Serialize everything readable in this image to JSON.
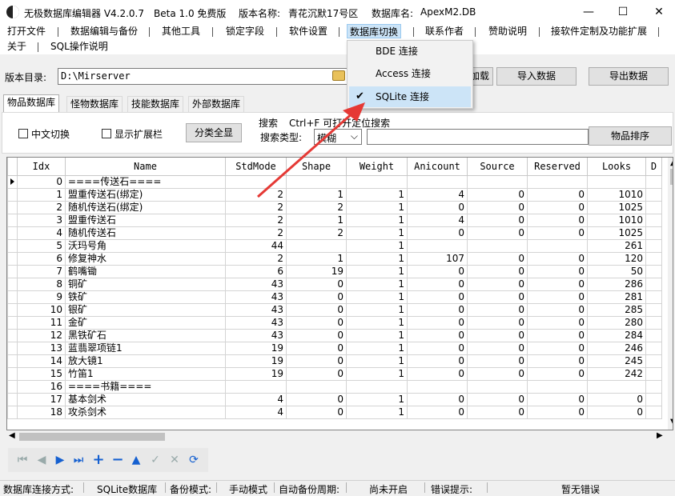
{
  "window": {
    "title": "无极数据库编辑器 V4.2.0.7",
    "edition": "Beta 1.0 免费版",
    "version_label": "版本名称:",
    "version_value": "青花沉默17号区",
    "db_label": "数据库名:",
    "db_value": "ApexM2.DB"
  },
  "menu": [
    "打开文件",
    "数据编辑与备份",
    "其他工具",
    "锁定字段",
    "软件设置",
    "数据库切换",
    "联系作者",
    "赞助说明",
    "接软件定制及功能扩展",
    "关于",
    "SQL操作说明"
  ],
  "dropdown": {
    "items": [
      "BDE 连接",
      "Access 连接",
      "SQLite 连接"
    ],
    "checked": 2
  },
  "pathbar": {
    "label": "版本目录:",
    "path": "D:\\Mirserver",
    "load_btn": "加载数",
    "import_btn": "导入数据",
    "export_btn": "导出数据"
  },
  "tabs": [
    "物品数据库",
    "怪物数据库",
    "技能数据库",
    "外部数据库"
  ],
  "toolpanel": {
    "chinese_switch": "中文切换",
    "show_ext": "显示扩展栏",
    "show_all": "分类全显",
    "search_label": "搜索",
    "search_hint": "Ctrl+F 可打开定位搜索",
    "search_type_label": "搜索类型:",
    "search_type_value": "模糊",
    "sort_btn": "物品排序"
  },
  "table": {
    "columns": [
      "Idx",
      "Name",
      "StdMode",
      "Shape",
      "Weight",
      "Anicount",
      "Source",
      "Reserved",
      "Looks",
      "D"
    ],
    "rows": [
      [
        "0",
        "====传送石====",
        "",
        "",
        "",
        "",
        "",
        "",
        ""
      ],
      [
        "1",
        "盟重传送石(绑定)",
        "2",
        "1",
        "1",
        "4",
        "0",
        "0",
        "1010"
      ],
      [
        "2",
        "随机传送石(绑定)",
        "2",
        "2",
        "1",
        "0",
        "0",
        "0",
        "1025"
      ],
      [
        "3",
        "盟重传送石",
        "2",
        "1",
        "1",
        "4",
        "0",
        "0",
        "1010"
      ],
      [
        "4",
        "随机传送石",
        "2",
        "2",
        "1",
        "0",
        "0",
        "0",
        "1025"
      ],
      [
        "5",
        "沃玛号角",
        "44",
        "",
        "1",
        "",
        "",
        "",
        "261"
      ],
      [
        "6",
        "修复神水",
        "2",
        "1",
        "1",
        "107",
        "0",
        "0",
        "120"
      ],
      [
        "7",
        "鹤嘴锄",
        "6",
        "19",
        "1",
        "0",
        "0",
        "0",
        "50"
      ],
      [
        "8",
        "铜矿",
        "43",
        "0",
        "1",
        "0",
        "0",
        "0",
        "286"
      ],
      [
        "9",
        "铁矿",
        "43",
        "0",
        "1",
        "0",
        "0",
        "0",
        "281"
      ],
      [
        "10",
        "银矿",
        "43",
        "0",
        "1",
        "0",
        "0",
        "0",
        "285"
      ],
      [
        "11",
        "金矿",
        "43",
        "0",
        "1",
        "0",
        "0",
        "0",
        "280"
      ],
      [
        "12",
        "黑铁矿石",
        "43",
        "0",
        "1",
        "0",
        "0",
        "0",
        "284"
      ],
      [
        "13",
        "蓝翡翠项链1",
        "19",
        "0",
        "1",
        "0",
        "0",
        "0",
        "246"
      ],
      [
        "14",
        "放大镜1",
        "19",
        "0",
        "1",
        "0",
        "0",
        "0",
        "245"
      ],
      [
        "15",
        "竹笛1",
        "19",
        "0",
        "1",
        "0",
        "0",
        "0",
        "242"
      ],
      [
        "16",
        "====书籍====",
        "",
        "",
        "",
        "",
        "",
        "",
        ""
      ],
      [
        "17",
        "基本剑术",
        "4",
        "0",
        "1",
        "0",
        "0",
        "0",
        "0"
      ],
      [
        "18",
        "攻杀剑术",
        "4",
        "0",
        "1",
        "0",
        "0",
        "0",
        "0"
      ]
    ]
  },
  "status": {
    "conn_label": "数据库连接方式:",
    "conn_value": "SQLite数据库",
    "backup_label": "备份模式:",
    "backup_value": "手动模式",
    "auto_label": "自动备份周期:",
    "auto_value": "尚未开启",
    "err_label": "错误提示:",
    "err_value": "暂无错误"
  },
  "colors": {
    "accent": "#cce4f7",
    "arrow": "#e53935"
  }
}
